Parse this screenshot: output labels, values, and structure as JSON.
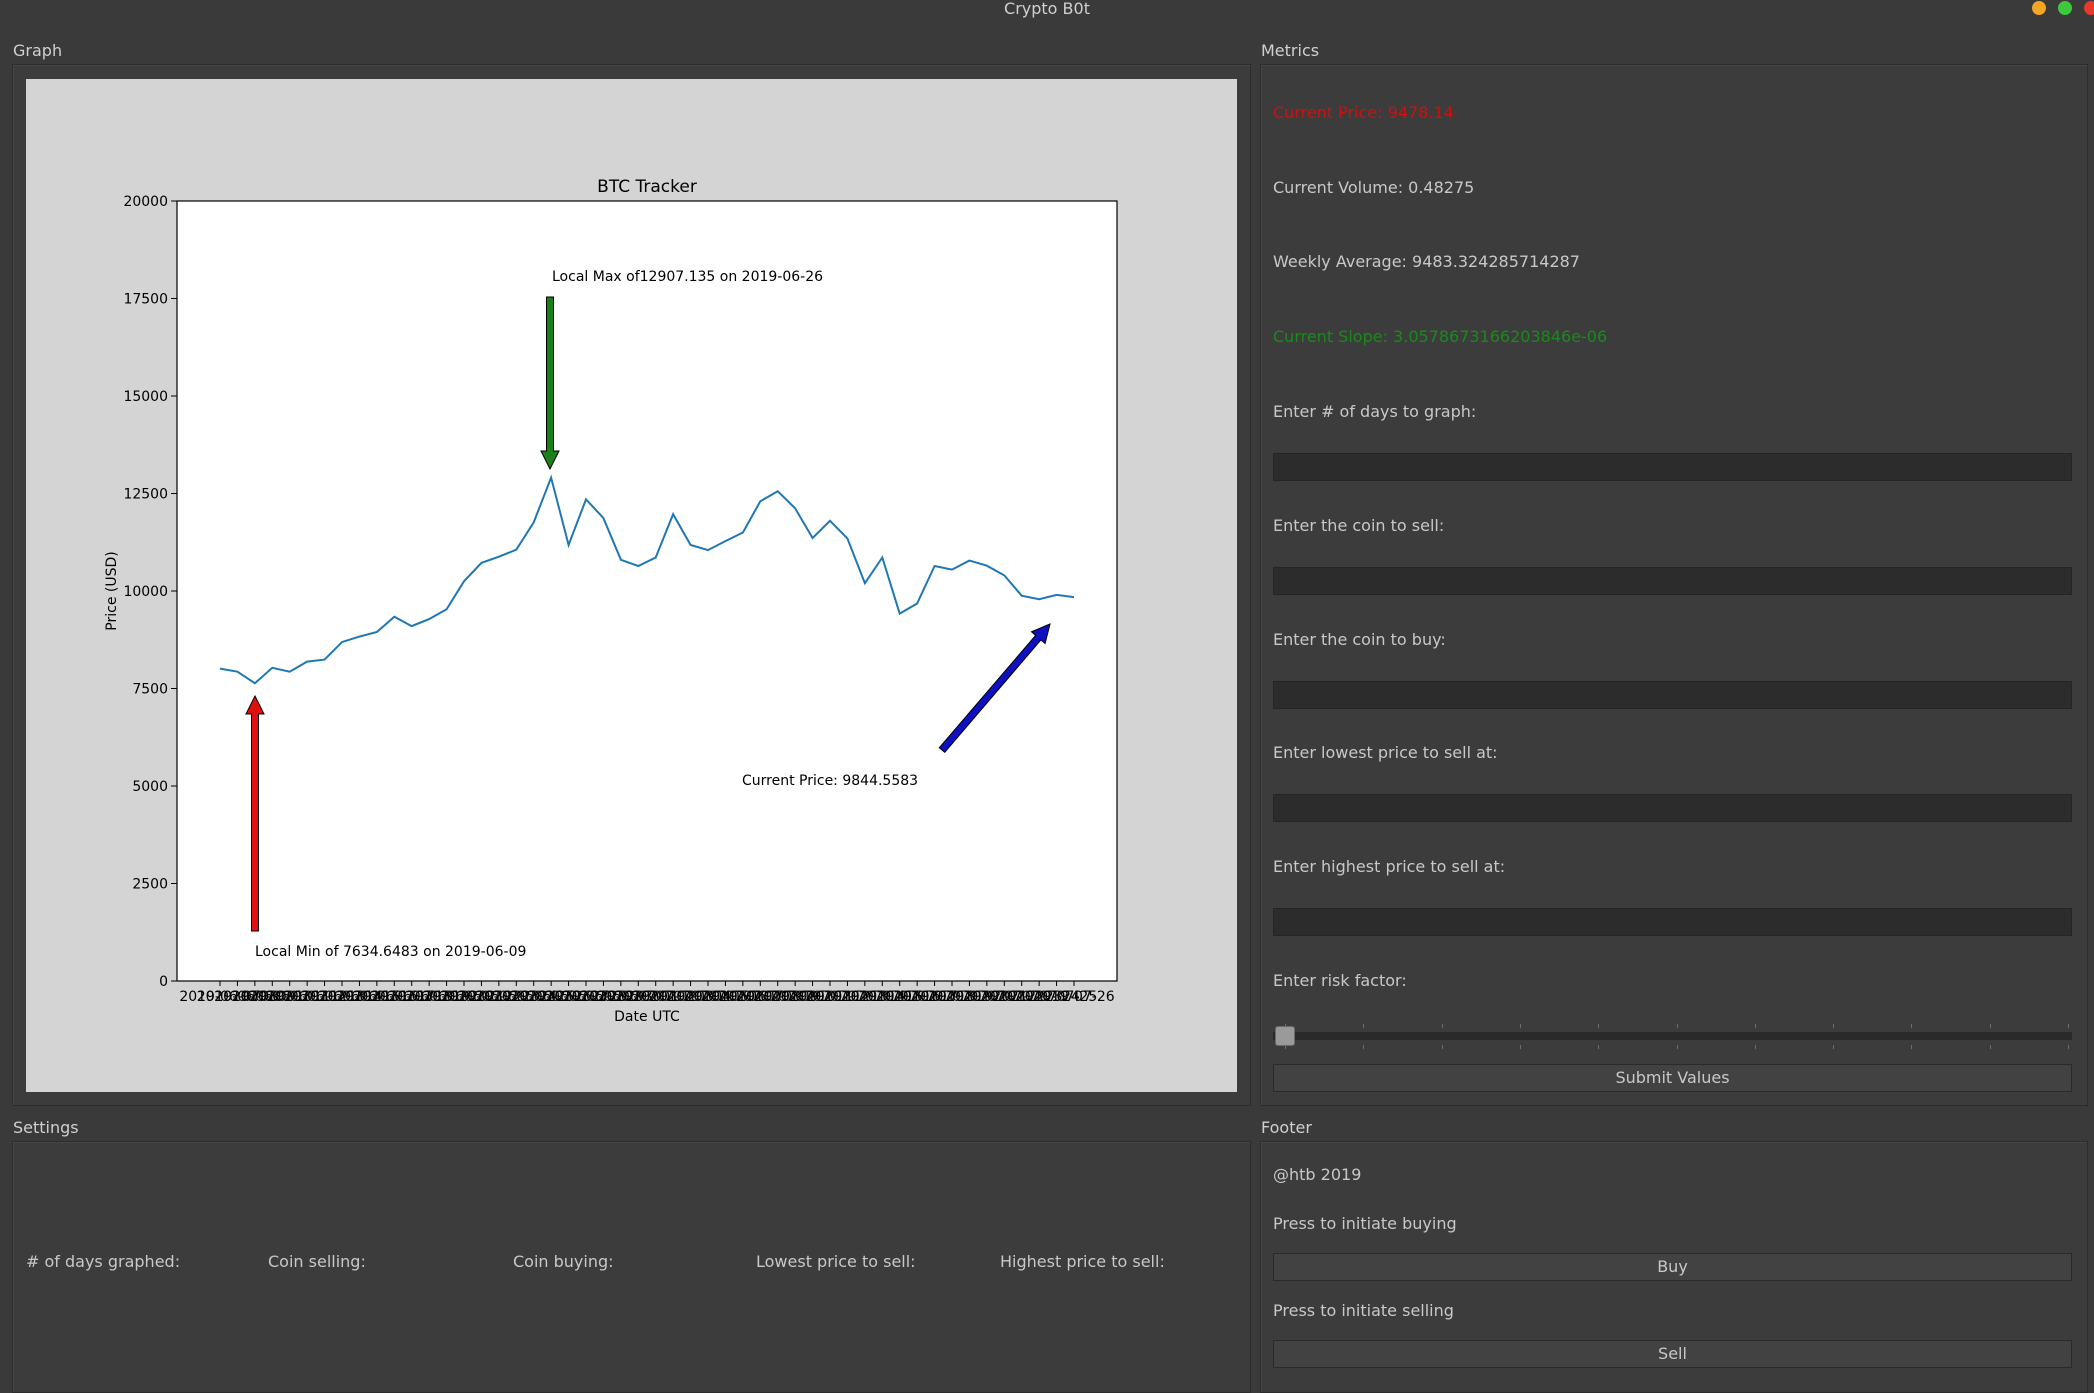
{
  "window": {
    "title": "Crypto B0t",
    "controls": {
      "minimize_color": "#f5a623",
      "maximize_color": "#3cc93c",
      "close_color": "#e8392c"
    }
  },
  "graph_panel": {
    "title": "Graph"
  },
  "chart_data": {
    "type": "line",
    "title": "BTC Tracker",
    "xlabel": "Date UTC",
    "ylabel": "Price (USD)",
    "ylim": [
      0,
      20000
    ],
    "yticks": [
      0,
      2500,
      5000,
      7500,
      10000,
      12500,
      15000,
      17500,
      20000
    ],
    "xtick_labels_visible": [
      "2019",
      "726"
    ],
    "x_start_date": "2019-06-07",
    "line_color": "#1f77b4",
    "series": [
      {
        "name": "BTC",
        "values": [
          8010,
          7930,
          7634.6483,
          8030,
          7930,
          8190,
          8240,
          8690,
          8830,
          8950,
          9340,
          9100,
          9280,
          9530,
          10250,
          10720,
          10880,
          11060,
          11760,
          12907.135,
          11180,
          12350,
          11870,
          10800,
          10640,
          10860,
          11970,
          11180,
          11050,
          11280,
          11500,
          12300,
          12560,
          12120,
          11360,
          11800,
          11350,
          10200,
          10860,
          9420,
          9680,
          10640,
          10550,
          10780,
          10650,
          10400,
          9880,
          9790,
          9900,
          9844.5583
        ]
      }
    ],
    "annotations": [
      {
        "text": "Local Max of12907.135 on 2019-06-26",
        "arrow_color": "#1a801a"
      },
      {
        "text": "Local Min of 7634.6483 on 2019-06-09",
        "arrow_color": "#e01010"
      },
      {
        "text": "Current Price: 9844.5583",
        "arrow_color": "#1010c0"
      }
    ],
    "background": "#d4d4d4",
    "grid": false
  },
  "metrics_panel": {
    "title": "Metrics",
    "current_price": "Current Price: 9478.14",
    "current_price_color": "#cc1111",
    "current_volume": "Current Volume: 0.48275",
    "weekly_average": "Weekly Average: 9483.324285714287",
    "current_slope": "Current Slope: 3.0578673166203846e-06",
    "current_slope_color": "#1a8a1a",
    "days_label": "Enter # of days to graph:",
    "days_value": "",
    "sell_coin_label": "Enter the coin to sell:",
    "sell_coin_value": "",
    "buy_coin_label": "Enter the coin to buy:",
    "buy_coin_value": "",
    "lowest_label": "Enter lowest price to sell at:",
    "lowest_value": "",
    "highest_label": "Enter highest price to sell at:",
    "highest_value": "",
    "risk_label": "Enter risk factor:",
    "risk_value": 0,
    "submit_label": "Submit Values"
  },
  "settings_panel": {
    "title": "Settings",
    "days_graphed": "# of days graphed:",
    "coin_selling": "Coin selling:",
    "coin_buying": "Coin buying:",
    "lowest_price": "Lowest price to sell:",
    "highest_price": "Highest price to sell:"
  },
  "footer_panel": {
    "title": "Footer",
    "copyright": "@htb 2019",
    "buy_prompt": "Press to initiate buying",
    "buy_label": "Buy",
    "sell_prompt": "Press to initiate selling",
    "sell_label": "Sell"
  }
}
